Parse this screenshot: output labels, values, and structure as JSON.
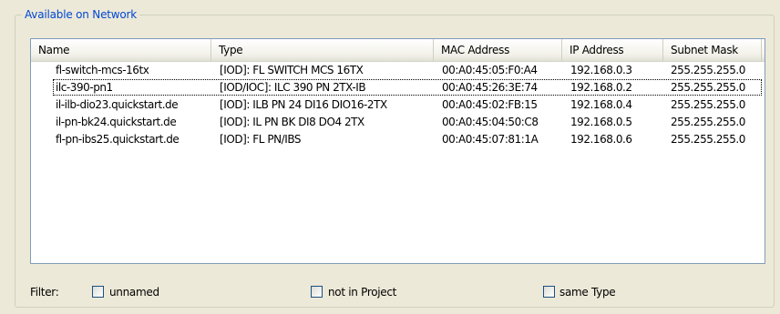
{
  "group_title": "Available on Network",
  "columns": [
    "Name",
    "Type",
    "MAC Address",
    "IP Address",
    "Subnet Mask"
  ],
  "rows": [
    [
      "fl-switch-mcs-16tx",
      "[IOD]: FL SWITCH MCS 16TX",
      "00:A0:45:05:F0:A4",
      "192.168.0.3",
      "255.255.255.0"
    ],
    [
      "ilc-390-pn1",
      "[IOD/IOC]: ILC 390 PN 2TX-IB",
      "00:A0:45:26:3E:74",
      "192.168.0.2",
      "255.255.255.0"
    ],
    [
      "il-ilb-dio23.quickstart.de",
      "[IOD]: ILB PN 24 DI16 DIO16-2TX",
      "00:A0:45:02:FB:15",
      "192.168.0.4",
      "255.255.255.0"
    ],
    [
      "il-pn-bk24.quickstart.de",
      "[IOD]: IL PN BK DI8 DO4 2TX",
      "00:A0:45:04:50:C8",
      "192.168.0.5",
      "255.255.255.0"
    ],
    [
      "fl-pn-ibs25.quickstart.de",
      "[IOD]: FL PN/IBS",
      "00:A0:45:07:81:1A",
      "192.168.0.6",
      "255.255.255.0"
    ]
  ],
  "focused_row": 1,
  "filter": {
    "label": "Filter:",
    "options": [
      {
        "label": "unnamed",
        "checked": false
      },
      {
        "label": "not in Project",
        "checked": false
      },
      {
        "label": "same Type",
        "checked": false
      }
    ]
  }
}
